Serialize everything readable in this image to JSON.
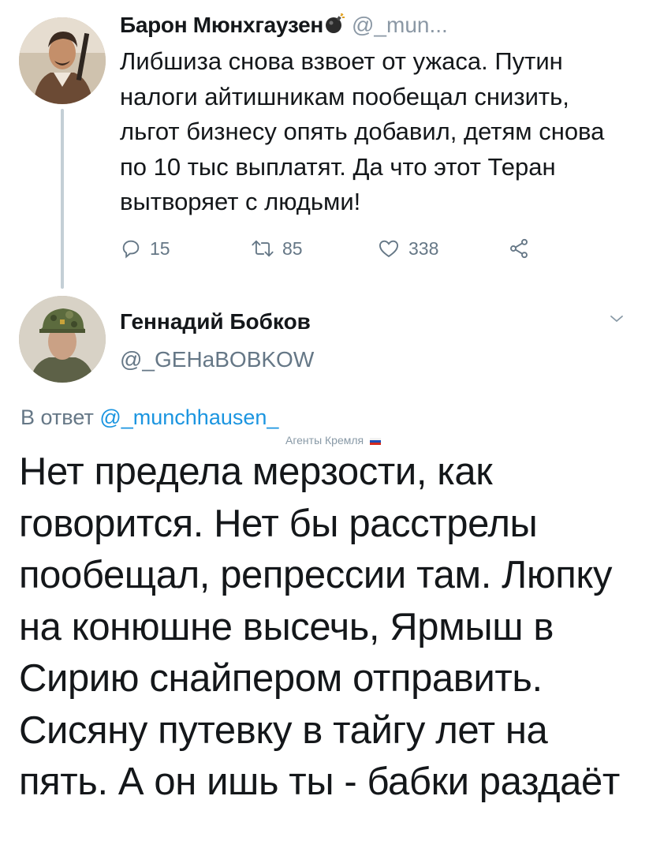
{
  "parent_tweet": {
    "author_name": "Барон Мюнхгаузен",
    "handle": "@_mun...",
    "text": "Либшиза снова взвоет от ужаса. Путин налоги айтишникам пообещал снизить, льгот бизнесу опять добавил, детям снова по 10 тыс выплатят. Да что этот Теран вытворяет с людьми!",
    "replies": "15",
    "retweets": "85",
    "likes": "338"
  },
  "reply_tweet": {
    "author_name": "Геннадий Бобков",
    "handle": "@_GEHaBOBKOW",
    "reply_to_prefix": "В ответ",
    "reply_to_handle": "@_munchhausen_",
    "badge_label": "Агенты Кремля",
    "text": "Нет предела мерзости, как говорится. Нет бы расстрелы пообещал, репрессии там. Люпку на конюшне высечь, Ярмыш в Сирию снайпером отправить. Сисяну путевку в тайгу лет на пять. А он ишь ты - бабки раздаёт"
  },
  "colors": {
    "text": "#14171a",
    "secondary": "#657786",
    "link": "#1b95e0",
    "thread_line": "#c4cfd6"
  },
  "icons": [
    "bomb-icon",
    "reply-icon",
    "retweet-icon",
    "like-icon",
    "share-icon",
    "chevron-down-icon",
    "russian-flag-icon"
  ]
}
